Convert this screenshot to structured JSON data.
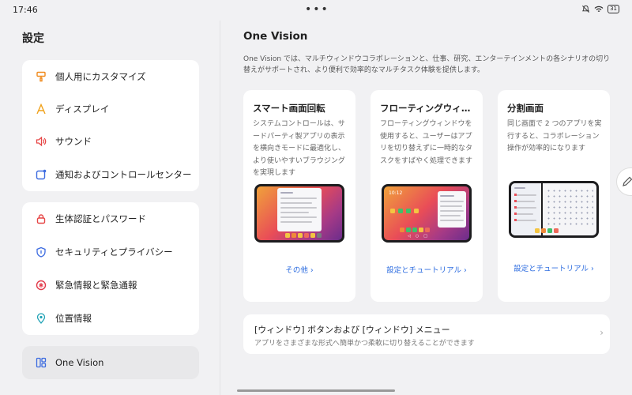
{
  "status": {
    "time": "17:46",
    "battery": "31"
  },
  "settings_title": "設定",
  "sidebar": {
    "group1": [
      {
        "label": "個人用にカスタマイズ",
        "icon": "paint-roller-icon"
      },
      {
        "label": "ディスプレイ",
        "icon": "display-icon"
      },
      {
        "label": "サウンド",
        "icon": "speaker-icon"
      },
      {
        "label": "通知およびコントロールセンター",
        "icon": "notification-icon"
      }
    ],
    "group2": [
      {
        "label": "生体認証とパスワード",
        "icon": "lock-icon"
      },
      {
        "label": "セキュリティとプライバシー",
        "icon": "shield-icon"
      },
      {
        "label": "緊急情報と緊急通報",
        "icon": "emergency-icon"
      },
      {
        "label": "位置情報",
        "icon": "location-icon"
      }
    ],
    "selected": {
      "label": "One Vision",
      "icon": "multiwindow-icon"
    }
  },
  "main": {
    "title": "One Vision",
    "description": "One Vision では、マルチウィンドウコラボレーションと、仕事、研究、エンターテインメントの各シナリオの切り替えがサポートされ、より便利で効率的なマルチタスク体験を提供します。",
    "cards": [
      {
        "title": "スマート画面回転",
        "description": "システムコントロールは、サードパーティ製アプリの表示を横向きモードに最適化し、より使いやすいブラウジングを実現します",
        "link": "その他 ›"
      },
      {
        "title": "フローティングウィンドウ",
        "description": "フローティングウィンドウを使用すると、ユーザーはアプリを切り替えずに一時的なタスクをすばやく処理できます",
        "link": "設定とチュートリアル ›",
        "clock": "10:12"
      },
      {
        "title": "分割画面",
        "description": "同じ画面で 2 つのアプリを実行すると、コラボレーション操作が効率的になります",
        "link": "設定とチュートリアル ›"
      }
    ],
    "window_row": {
      "title": "[ウィンドウ] ボタンおよび [ウィンドウ] メニュー",
      "subtitle": "アプリをさまざまな形式へ簡単かつ柔軟に切り替えることができます",
      "chevron": "›"
    }
  },
  "colors": {
    "link": "#2f6ee0",
    "selected_bg": "#e8e8ea"
  }
}
